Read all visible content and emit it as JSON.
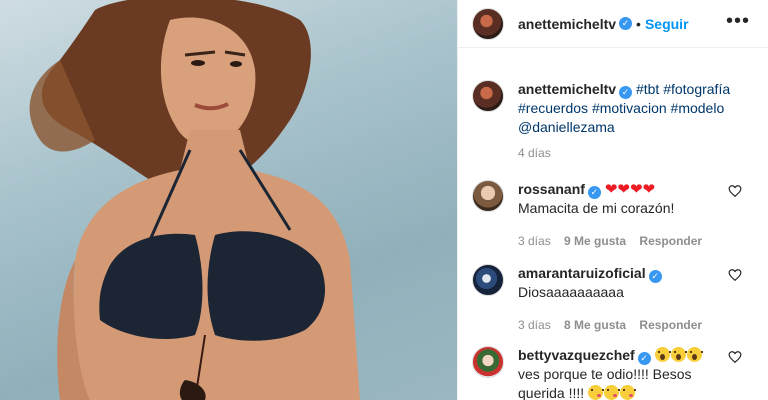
{
  "post": {
    "image_alt": "",
    "author": "anettemicheltv",
    "follow_label": "Seguir",
    "more_label": "•••",
    "separator": "•"
  },
  "caption": {
    "author": "anettemicheltv",
    "hashtags": [
      "#tbt",
      "#fotografía",
      "#recuerdos",
      "#motivacion",
      "#modelo"
    ],
    "mention": "@daniellezama",
    "time": "4 días"
  },
  "comments": [
    {
      "user": "rossananf",
      "text": "Mamacita de mi corazón!",
      "emojis": "hearts",
      "time": "3 días",
      "likes": "9 Me gusta",
      "reply": "Responder"
    },
    {
      "user": "amarantaruizoficial",
      "text": "Diosaaaaaaaaaa",
      "time": "3 días",
      "likes": "8 Me gusta",
      "reply": "Responder"
    },
    {
      "user": "bettyvazquezchef",
      "text_line1": "ves porque te odio!!!! Besos",
      "text_line2": "querida !!!!",
      "emojis": "shocked"
    }
  ],
  "icons": {
    "verified": "verified-badge-icon",
    "heart": "heart-outline-icon",
    "more": "more-horizontal-icon"
  },
  "colors": {
    "link": "#00376b",
    "follow": "#0095f6",
    "verified": "#3897f0",
    "muted": "#8e8e8e"
  }
}
